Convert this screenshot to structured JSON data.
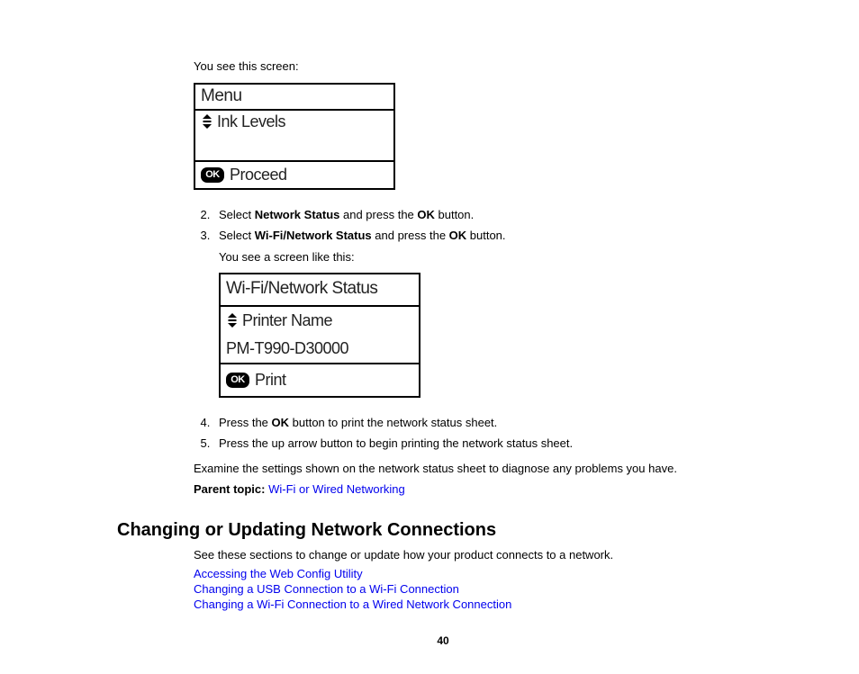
{
  "intro": "You see this screen:",
  "screen1": {
    "title": "Menu",
    "row1": "Ink Levels",
    "footer_badge": "OK",
    "footer": "Proceed"
  },
  "step2": {
    "num": "2.",
    "prefix": "Select ",
    "bold1": "Network Status",
    "mid": " and press the ",
    "bold2": "OK",
    "suffix": " button."
  },
  "step3": {
    "num": "3.",
    "prefix": "Select ",
    "bold1": "Wi-Fi/Network Status",
    "mid": " and press the ",
    "bold2": "OK",
    "suffix": " button.",
    "after": "You see a screen like this:"
  },
  "screen2": {
    "title": "Wi-Fi/Network Status",
    "row1": "Printer Name",
    "row2": "PM-T990-D30000",
    "footer_badge": "OK",
    "footer": "Print"
  },
  "step4": {
    "num": "4.",
    "prefix": "Press the ",
    "bold1": "OK",
    "suffix": " button to print the network status sheet."
  },
  "step5": {
    "num": "5.",
    "text": "Press the up arrow button to begin printing the network status sheet."
  },
  "examine": "Examine the settings shown on the network status sheet to diagnose any problems you have.",
  "parent_topic_label": "Parent topic: ",
  "parent_topic_link": "Wi-Fi or Wired Networking",
  "heading": "Changing or Updating Network Connections",
  "heading_intro": "See these sections to change or update how your product connects to a network.",
  "links": {
    "l1": "Accessing the Web Config Utility",
    "l2": "Changing a USB Connection to a Wi-Fi Connection",
    "l3": "Changing a Wi-Fi Connection to a Wired Network Connection"
  },
  "page_number": "40"
}
